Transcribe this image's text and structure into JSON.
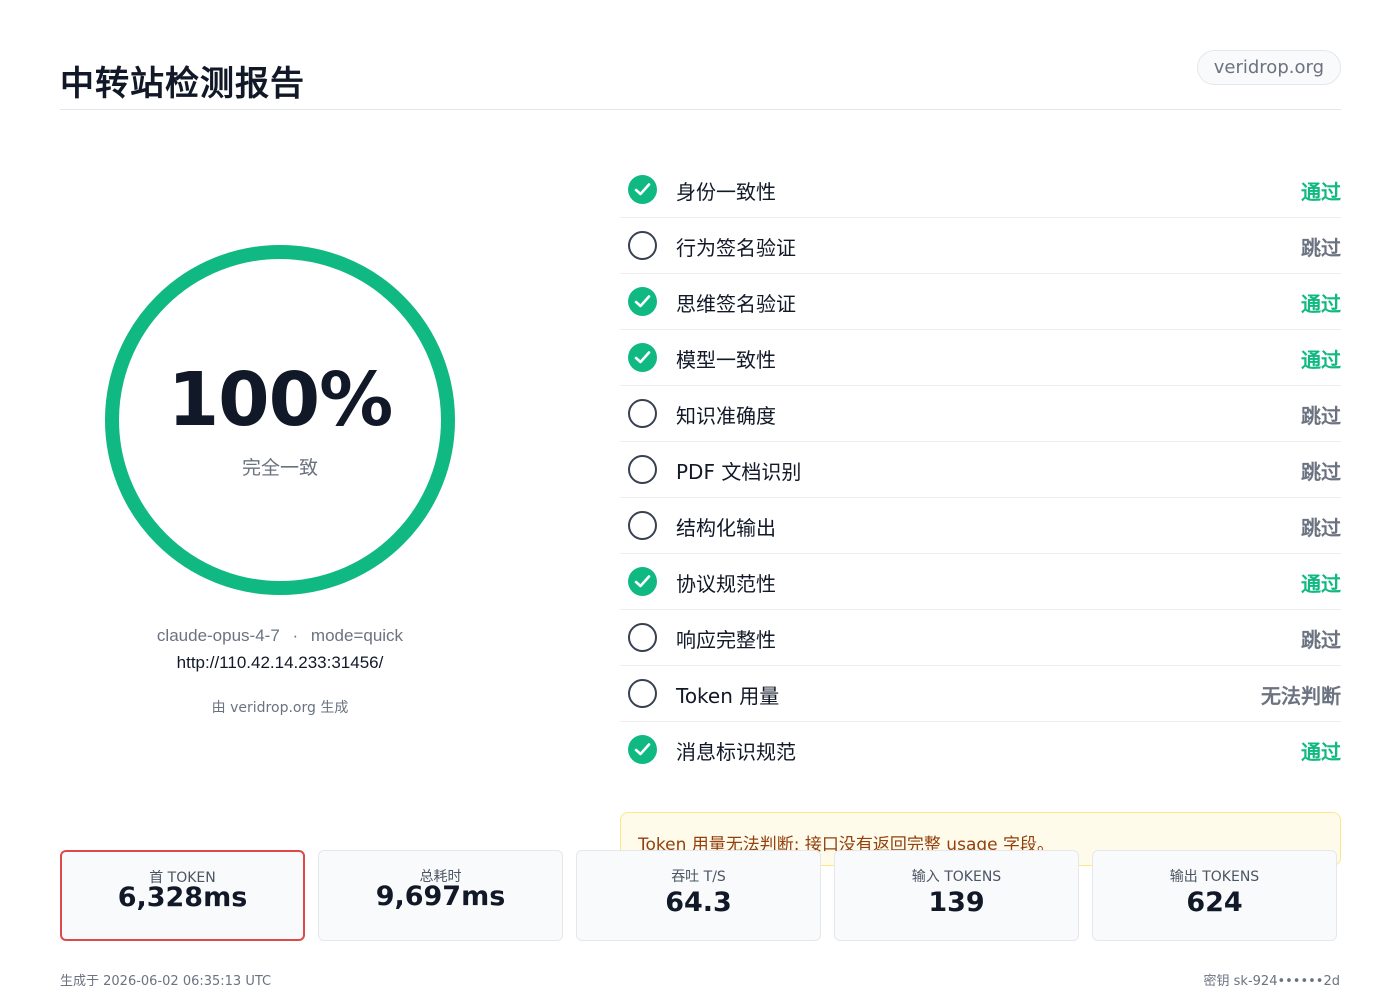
{
  "header": {
    "title": "中转站检测报告",
    "domain": "veridrop.org"
  },
  "score": {
    "value": "100%",
    "label": "完全一致",
    "fraction": 1.0,
    "ring_color": "#10b981"
  },
  "meta": {
    "model": "claude-opus-4-7",
    "separator": "·",
    "mode": "mode=quick",
    "url": "http://110.42.14.233:31456/",
    "generated_by": "由 veridrop.org 生成"
  },
  "checks": [
    {
      "name": "身份一致性",
      "status": "通过",
      "state": "pass"
    },
    {
      "name": "行为签名验证",
      "status": "跳过",
      "state": "skip"
    },
    {
      "name": "思维签名验证",
      "status": "通过",
      "state": "pass"
    },
    {
      "name": "模型一致性",
      "status": "通过",
      "state": "pass"
    },
    {
      "name": "知识准确度",
      "status": "跳过",
      "state": "skip"
    },
    {
      "name": "PDF 文档识别",
      "status": "跳过",
      "state": "skip"
    },
    {
      "name": "结构化输出",
      "status": "跳过",
      "state": "skip"
    },
    {
      "name": "协议规范性",
      "status": "通过",
      "state": "pass"
    },
    {
      "name": "响应完整性",
      "status": "跳过",
      "state": "skip"
    },
    {
      "name": "Token 用量",
      "status": "无法判断",
      "state": "skip"
    },
    {
      "name": "消息标识规范",
      "status": "通过",
      "state": "pass"
    }
  ],
  "notice": "Token 用量无法判断: 接口没有返回完整 usage 字段。",
  "stats": [
    {
      "label": "首 TOKEN",
      "value": "6,328ms"
    },
    {
      "label": "总耗时",
      "value": "9,697ms"
    },
    {
      "label": "吞吐 T/S",
      "value": "64.3"
    },
    {
      "label": "输入 TOKENS",
      "value": "139"
    },
    {
      "label": "输出 TOKENS",
      "value": "624"
    }
  ],
  "footer": {
    "generated_at": "生成于 2026-06-02 06:35:13 UTC",
    "key": "密钥 sk-924••••••2d"
  },
  "colors": {
    "pass": "#10b981",
    "skip": "#6b7280",
    "highlight_border": "#dc4a4a"
  }
}
